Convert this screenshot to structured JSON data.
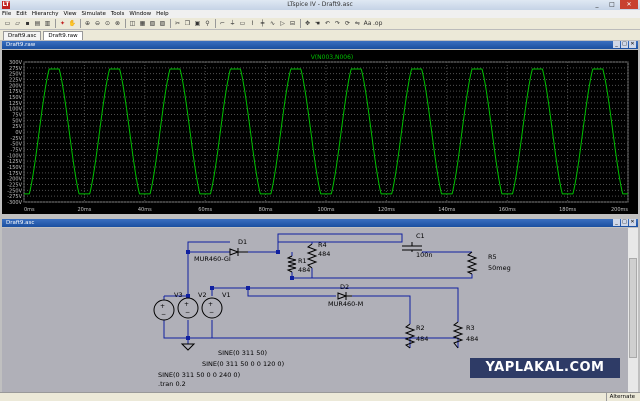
{
  "window": {
    "title": "LTspice IV - Draft9.asc",
    "controls": [
      "_",
      "□",
      "✕"
    ]
  },
  "menu": [
    "File",
    "Edit",
    "Hierarchy",
    "View",
    "Simulate",
    "Tools",
    "Window",
    "Help"
  ],
  "toolbar": {
    "icons": [
      "open-icon",
      "open-folder-icon",
      "save-icon",
      "print-setup-icon",
      "print-icon",
      "run-icon",
      "halt-icon",
      "zoom-in-icon",
      "zoom-out-icon",
      "zoom-fit-icon",
      "zoom-all-icon",
      "cut-icon",
      "copy-icon",
      "paste-icon",
      "find-icon",
      "autoscale-icon",
      "tile-vert-icon",
      "tile-horiz-icon",
      "cascade-icon",
      "close-icon",
      "wire-icon",
      "ground-icon",
      "label-icon",
      "resistor-icon",
      "capacitor-icon",
      "inductor-icon",
      "diode-icon",
      "component-icon",
      "move-icon",
      "drag-icon",
      "undo-icon",
      "redo-icon",
      "rotate-icon",
      "mirror-icon",
      "text-icon",
      "spice-directive-icon"
    ]
  },
  "tabs": [
    {
      "label": "Draft9.asc"
    },
    {
      "label": "Draft9.raw"
    }
  ],
  "waveform_window": {
    "title": "Draft9.raw"
  },
  "schematic_window": {
    "title": "Draft9.asc"
  },
  "chart_data": {
    "type": "line",
    "title": "V(N003,N006)",
    "xlabel": "",
    "ylabel": "",
    "x_ticks": [
      "0ms",
      "20ms",
      "40ms",
      "60ms",
      "80ms",
      "100ms",
      "120ms",
      "140ms",
      "160ms",
      "180ms",
      "200ms"
    ],
    "y_ticks": [
      "300V",
      "275V",
      "250V",
      "225V",
      "200V",
      "175V",
      "150V",
      "125V",
      "100V",
      "75V",
      "50V",
      "25V",
      "0V",
      "-25V",
      "-50V",
      "-75V",
      "-100V",
      "-125V",
      "-150V",
      "-175V",
      "-200V",
      "-225V",
      "-250V",
      "-275V",
      "-300V"
    ],
    "xlim": [
      0,
      200
    ],
    "ylim": [
      -300,
      300
    ],
    "grid": true,
    "series": [
      {
        "name": "V(N003,N006)",
        "color": "#00c000",
        "description_of_shape": null,
        "amplitude": 311,
        "frequency_hz": 50,
        "upper_clip": 270,
        "lower_clip": -265,
        "t_start_ms": 0,
        "t_end_ms": 200
      }
    ]
  },
  "schematic": {
    "labels": {
      "D1": "D1",
      "D1_model": "MUR460-GI",
      "D2": "D2",
      "D2_model": "MUR460-M",
      "R1": "R1",
      "R1_val": "484",
      "R2": "R2",
      "R2_val": "484",
      "R3": "R3",
      "R3_val": "484",
      "R4": "R4",
      "R4_val": "484",
      "R5": "R5",
      "R5_val": "50meg",
      "C1": "C1",
      "C1_val": "100n",
      "V1": "V1",
      "V2": "V2",
      "V3": "V3",
      "V1_src": "SINE(0 311 50)",
      "V2_src": "SINE(0 311 50 0 0 120 0)",
      "V3_src": "SINE(0 311 50 0 0 240 0)",
      "tran": ".tran 0.2"
    }
  },
  "watermark": "YAPLAKAL.COM",
  "status": {
    "mode": "Alternate"
  }
}
